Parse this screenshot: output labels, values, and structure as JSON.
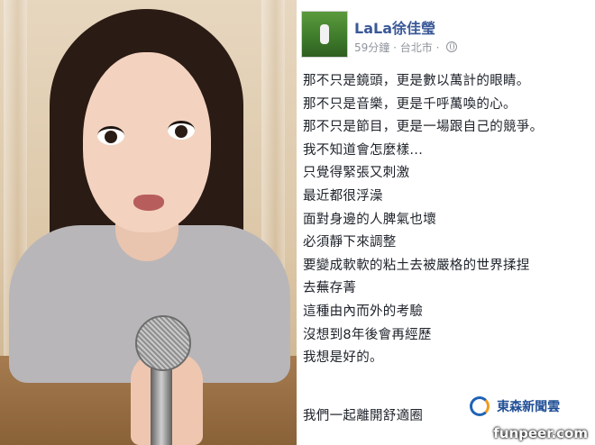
{
  "post": {
    "author": "LaLa徐佳瑩",
    "time": "59分鐘",
    "location": "台北市",
    "separator": "·",
    "privacy_icon": "globe-icon",
    "lines": [
      "那不只是鏡頭，更是數以萬計的眼睛。",
      "那不只是音樂，更是千呼萬喚的心。",
      "那不只是節目，更是一場跟自己的競爭。",
      "我不知道會怎麼樣...",
      "只覺得緊張又刺激",
      "最近都很浮澡",
      "面對身邊的人脾氣也壞",
      "必須靜下來調整",
      "要變成軟軟的粘土去被嚴格的世界揉捏",
      "去蕪存菁",
      "這種由內而外的考驗",
      "沒想到8年後會再經歷",
      "我想是好的。"
    ],
    "closing": "我們一起離開舒適圈"
  },
  "news_logo": {
    "text": "東森新聞雲"
  },
  "watermark": "funpeer.com",
  "colors": {
    "author_link": "#3b5998",
    "meta_text": "#90949c",
    "body_text": "#1d2129"
  }
}
